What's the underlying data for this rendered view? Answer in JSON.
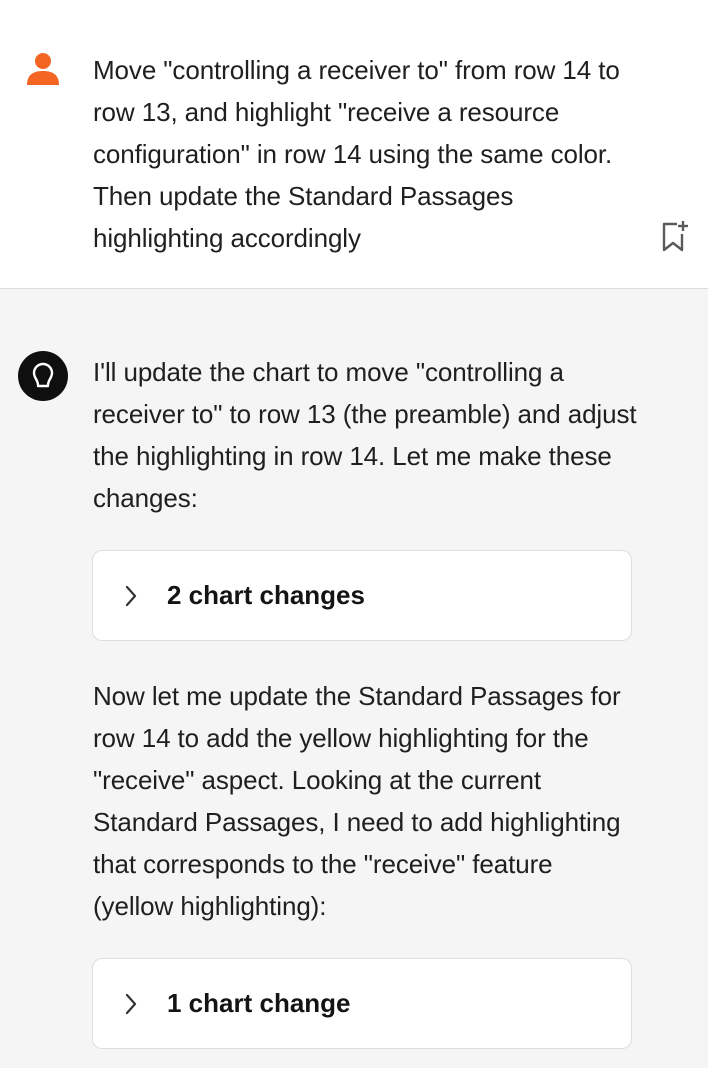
{
  "user_message": {
    "text": "Move \"controlling a receiver to\" from row 14 to row 13, and highlight \"receive a resource configuration\" in row 14 using the same color. Then update the Standard Passages highlighting accordingly",
    "avatar_icon": "person-icon",
    "bookmark_icon": "bookmark-add-icon",
    "avatar_color": "#f26522"
  },
  "assistant_message": {
    "avatar_icon": "lightbulb-icon",
    "paragraph_1": "I'll update the chart to move \"controlling a receiver to\" to row 13 (the preamble) and adjust the highlighting in row 14. Let me make these changes:",
    "card_1_label": "2 chart changes",
    "paragraph_2": "Now let me update the Standard Passages for row 14 to add the yellow highlighting for the \"receive\" aspect. Looking at the current Standard Passages, I need to add highlighting that corresponds to the \"receive\" feature (yellow highlighting):",
    "card_2_label": "1 chart change",
    "chevron_icon": "chevron-right-icon"
  }
}
